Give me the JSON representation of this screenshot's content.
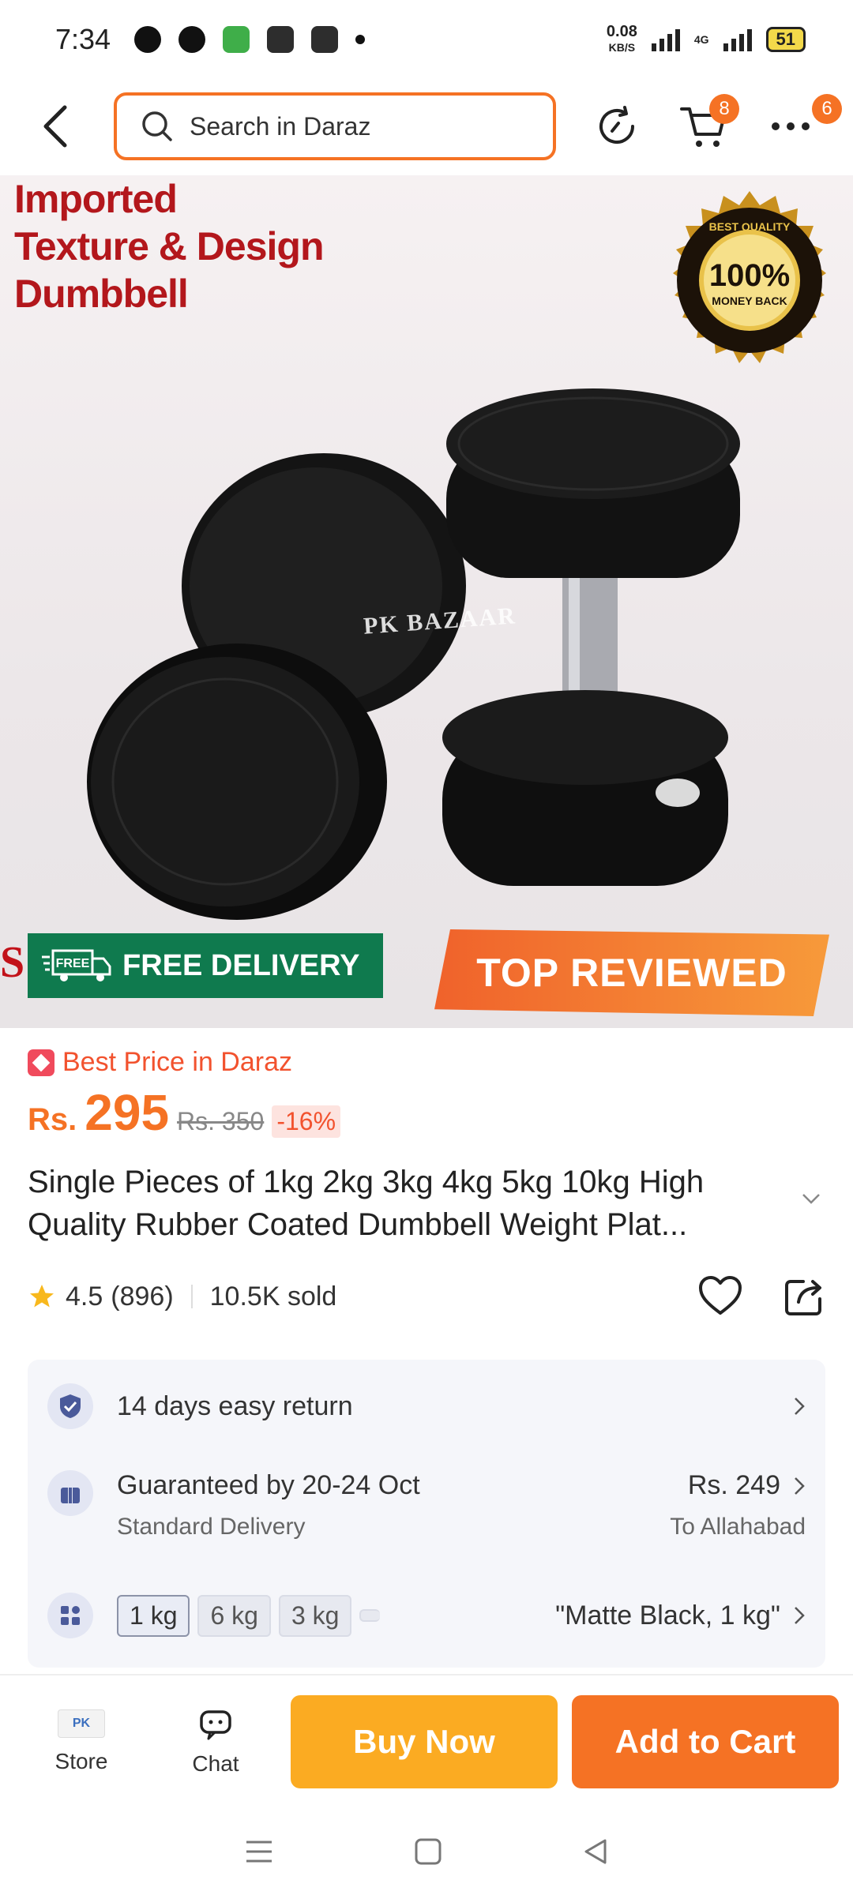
{
  "status_bar": {
    "time": "7:34",
    "speed_value": "0.08",
    "speed_unit": "KB/S",
    "network": "4G",
    "battery": "51"
  },
  "header": {
    "search_placeholder": "Search in Daraz",
    "cart_count": "8",
    "more_count": "6"
  },
  "hero": {
    "title_lines": [
      "Imported",
      "Texture & Design",
      "Dumbbell"
    ],
    "seal_top_text": "BEST QUALITY",
    "seal_main": "100%",
    "seal_sub": "MONEY BACK",
    "watermark": "PK BAZAAR",
    "free_delivery_icon_text": "FREE",
    "free_delivery": "FREE DELIVERY",
    "top_reviewed": "TOP REVIEWED",
    "colors": {
      "title_red": "#b3171c",
      "free_green": "#0f7a4e",
      "badge_orange": "#f0622b"
    }
  },
  "pricing": {
    "tag_label": "Best Price in Daraz",
    "currency": "Rs.",
    "price": "295",
    "original_price": "Rs. 350",
    "discount": "-16%"
  },
  "product": {
    "title": "Single Pieces of 1kg 2kg 3kg 4kg 5kg 10kg High Quality Rubber Coated Dumbbell Weight Plat...",
    "rating": "4.5",
    "reviews": "(896)",
    "sold": "10.5K sold"
  },
  "services": {
    "returns": "14 days easy return",
    "delivery_title": "Guaranteed by 20-24 Oct",
    "delivery_type": "Standard Delivery",
    "delivery_price": "Rs. 249",
    "delivery_location": "To Allahabad",
    "variants": [
      "1 kg",
      "6 kg",
      "3 kg"
    ],
    "selected_variant": "\"Matte Black, 1 kg\""
  },
  "bottom_bar": {
    "store_label": "Store",
    "store_logo_text": "PK",
    "chat_label": "Chat",
    "buy_now": "Buy Now",
    "add_to_cart": "Add to Cart",
    "colors": {
      "buy_now": "#fbab22",
      "add_to_cart": "#f57224"
    }
  }
}
